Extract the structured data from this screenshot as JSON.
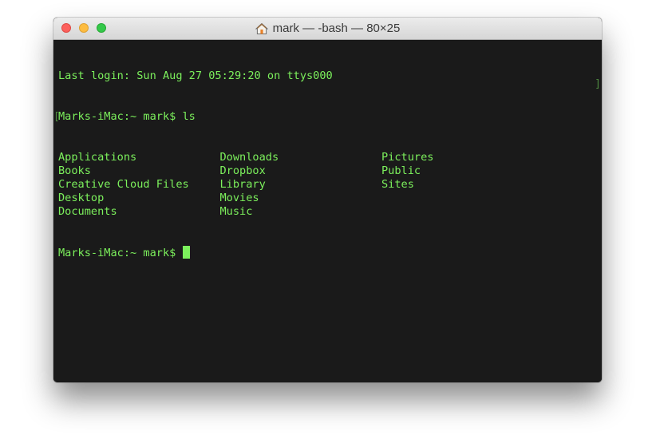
{
  "window": {
    "title": "mark — -bash — 80×25",
    "title_icon": "home-icon",
    "traffic_lights": [
      "close",
      "minimize",
      "zoom"
    ]
  },
  "terminal": {
    "colors": {
      "foreground": "#7cf05c",
      "background": "#1a1a1a"
    },
    "last_login": "Last login: Sun Aug 27 05:29:20 on ttys000",
    "command_line": "Marks-iMac:~ mark$ ls",
    "mark_bracket_left": "[",
    "mark_bracket_right": "]",
    "ls_output": [
      [
        "Applications",
        "Downloads",
        "Pictures"
      ],
      [
        "Books",
        "Dropbox",
        "Public"
      ],
      [
        "Creative Cloud Files",
        "Library",
        "Sites"
      ],
      [
        "Desktop",
        "Movies",
        ""
      ],
      [
        "Documents",
        "Music",
        ""
      ]
    ],
    "prompt": "Marks-iMac:~ mark$ "
  }
}
